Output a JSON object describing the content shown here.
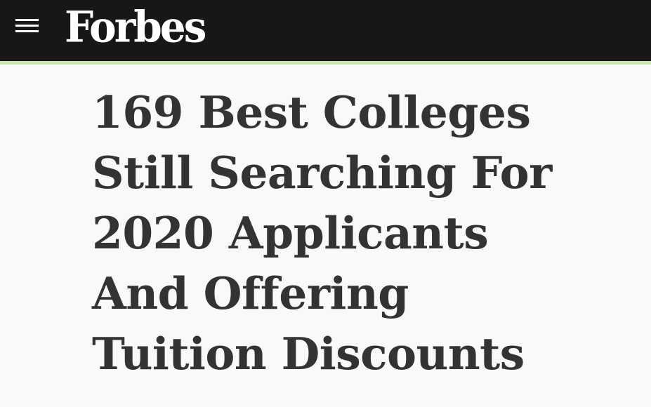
{
  "header": {
    "logo_text": "Forbes",
    "menu_icon": "hamburger-menu-icon",
    "background_color": "#181716",
    "accent_line_color": "#cce5b2"
  },
  "article": {
    "headline_lines": [
      "169 Best Colleges",
      "Still Searching For",
      "2020 Applicants",
      "And Offering",
      "Tuition Discounts"
    ],
    "headline_color": "#333333"
  }
}
